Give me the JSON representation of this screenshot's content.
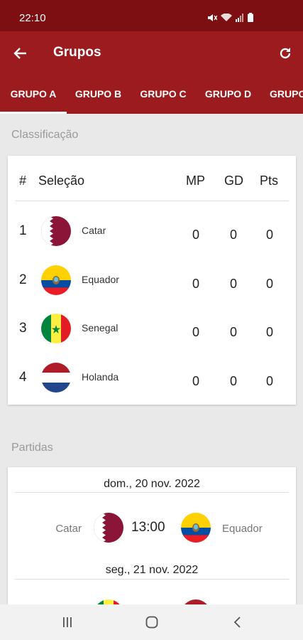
{
  "status": {
    "time": "22:10"
  },
  "app_bar": {
    "title": "Grupos",
    "back_icon": "arrow-back-icon",
    "refresh_icon": "refresh-icon"
  },
  "tabs": [
    {
      "label": "GRUPO A",
      "selected": true
    },
    {
      "label": "GRUPO B",
      "selected": false
    },
    {
      "label": "GRUPO C",
      "selected": false
    },
    {
      "label": "GRUPO D",
      "selected": false
    },
    {
      "label": "GRUPO E",
      "selected": false
    }
  ],
  "standings": {
    "section_label": "Classificação",
    "headers": {
      "pos": "#",
      "team": "Seleção",
      "mp": "MP",
      "gd": "GD",
      "pts": "Pts"
    },
    "rows": [
      {
        "pos": "1",
        "team": "Catar",
        "flag": "qatar-flag-icon",
        "mp": "0",
        "gd": "0",
        "pts": "0"
      },
      {
        "pos": "2",
        "team": "Equador",
        "flag": "ecuador-flag-icon",
        "mp": "0",
        "gd": "0",
        "pts": "0"
      },
      {
        "pos": "3",
        "team": "Senegal",
        "flag": "senegal-flag-icon",
        "mp": "0",
        "gd": "0",
        "pts": "0"
      },
      {
        "pos": "4",
        "team": "Holanda",
        "flag": "netherlands-flag-icon",
        "mp": "0",
        "gd": "0",
        "pts": "0"
      }
    ]
  },
  "matches": {
    "section_label": "Partidas",
    "days": [
      {
        "date": "dom., 20 nov. 2022",
        "home": "Catar",
        "away": "Equador",
        "time": "13:00"
      },
      {
        "date": "seg., 21 nov. 2022"
      }
    ]
  },
  "colors": {
    "primary": "#9b1b1e",
    "status_bar": "#7d0f12",
    "background": "#e9e9e9"
  }
}
